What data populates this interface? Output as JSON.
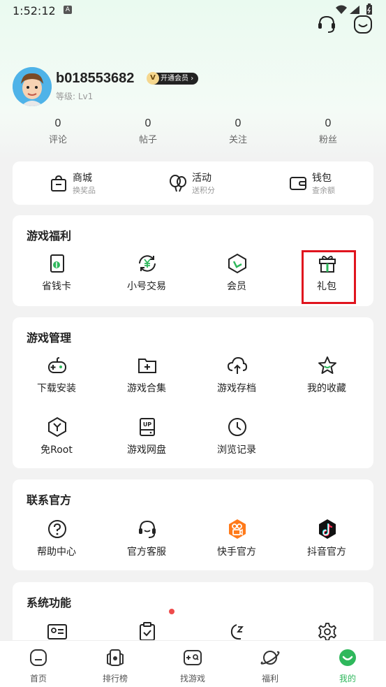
{
  "status_bar": {
    "time": "1:52:12",
    "notification_glyph": "A"
  },
  "top_actions": [
    "headset-icon",
    "smile-icon"
  ],
  "profile": {
    "username": "b018553682",
    "vip_label": "开通会员",
    "vip_icon_text": "V",
    "level": "等级: Lv1"
  },
  "stats": [
    {
      "value": "0",
      "label": "评论"
    },
    {
      "value": "0",
      "label": "帖子"
    },
    {
      "value": "0",
      "label": "关注"
    },
    {
      "value": "0",
      "label": "粉丝"
    }
  ],
  "quick_links": [
    {
      "title": "商城",
      "subtitle": "换奖品",
      "icon": "bag-icon"
    },
    {
      "title": "活动",
      "subtitle": "送积分",
      "icon": "balloon-icon"
    },
    {
      "title": "钱包",
      "subtitle": "查余额",
      "icon": "wallet-icon"
    }
  ],
  "game_benefits": {
    "title": "游戏福利",
    "items": [
      {
        "label": "省钱卡",
        "icon": "savings-card-icon"
      },
      {
        "label": "小号交易",
        "icon": "yen-exchange-icon"
      },
      {
        "label": "会员",
        "icon": "vip-hex-icon"
      },
      {
        "label": "礼包",
        "icon": "gift-icon"
      }
    ]
  },
  "game_management": {
    "title": "游戏管理",
    "items": [
      {
        "label": "下载安装",
        "icon": "gamepad-icon"
      },
      {
        "label": "游戏合集",
        "icon": "folder-plus-icon"
      },
      {
        "label": "游戏存档",
        "icon": "cloud-upload-icon"
      },
      {
        "label": "我的收藏",
        "icon": "star-icon"
      },
      {
        "label": "免Root",
        "icon": "hex-y-icon"
      },
      {
        "label": "游戏网盘",
        "icon": "drive-up-icon"
      },
      {
        "label": "浏览记录",
        "icon": "clock-icon"
      }
    ]
  },
  "contact": {
    "title": "联系官方",
    "items": [
      {
        "label": "帮助中心",
        "icon": "help-icon"
      },
      {
        "label": "官方客服",
        "icon": "support-headset-icon"
      },
      {
        "label": "快手官方",
        "icon": "kuaishou-icon"
      },
      {
        "label": "抖音官方",
        "icon": "douyin-icon"
      }
    ]
  },
  "system": {
    "title": "系统功能"
  },
  "bottom_nav": [
    {
      "label": "首页",
      "icon": "home-icon"
    },
    {
      "label": "排行榜",
      "icon": "ranking-icon"
    },
    {
      "label": "找游戏",
      "icon": "find-game-icon"
    },
    {
      "label": "福利",
      "icon": "planet-icon"
    },
    {
      "label": "我的",
      "icon": "me-icon",
      "active": true
    }
  ],
  "colors": {
    "accent": "#2fb85c",
    "highlight": "#e0141e",
    "kuaishou": "#ff7a1a",
    "douyin": "#111111"
  }
}
